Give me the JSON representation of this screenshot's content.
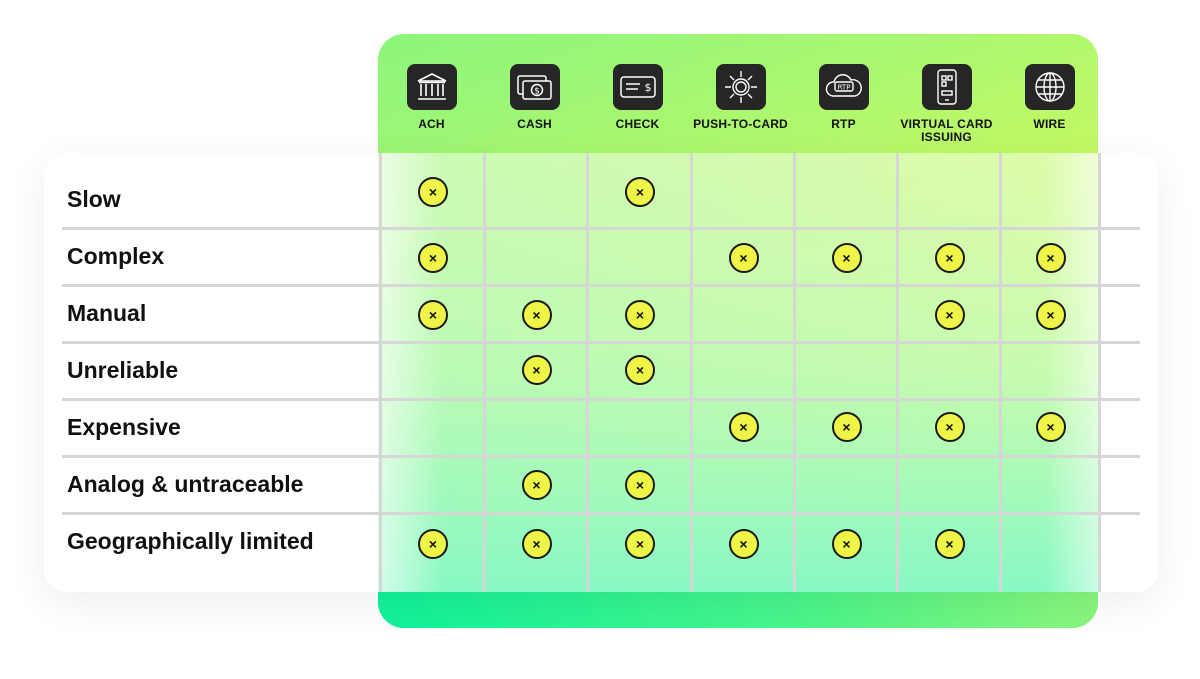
{
  "columns": [
    {
      "label": "ACH",
      "icon": "bank-icon"
    },
    {
      "label": "CASH",
      "icon": "cash-icon"
    },
    {
      "label": "CHECK",
      "icon": "check-icon"
    },
    {
      "label": "PUSH-TO-CARD",
      "icon": "push-to-card-icon"
    },
    {
      "label": "RTP",
      "icon": "rtp-cloud-icon"
    },
    {
      "label": "VIRTUAL CARD ISSUING",
      "icon": "virtual-card-phone-icon"
    },
    {
      "label": "WIRE",
      "icon": "globe-icon"
    }
  ],
  "rows": [
    {
      "label": "Slow",
      "marks": [
        1,
        0,
        1,
        0,
        0,
        0,
        0
      ]
    },
    {
      "label": "Complex",
      "marks": [
        1,
        0,
        0,
        1,
        1,
        1,
        1
      ]
    },
    {
      "label": "Manual",
      "marks": [
        1,
        1,
        1,
        0,
        0,
        1,
        1
      ]
    },
    {
      "label": "Unreliable",
      "marks": [
        0,
        1,
        1,
        0,
        0,
        0,
        0
      ]
    },
    {
      "label": "Expensive",
      "marks": [
        0,
        0,
        0,
        1,
        1,
        1,
        1
      ]
    },
    {
      "label": "Analog & untraceable",
      "marks": [
        0,
        1,
        1,
        0,
        0,
        0,
        0
      ]
    },
    {
      "label": "Geographically limited",
      "marks": [
        1,
        1,
        1,
        1,
        1,
        1,
        0
      ]
    }
  ],
  "mark_symbol": "×",
  "colors": {
    "mark_fill": "#eef546",
    "gradient_green": "#10f29a",
    "gradient_lime": "#8cf57c",
    "gradient_yellow": "#eefb50",
    "icon_bg": "#262626",
    "grid": "#d6d6d6"
  }
}
